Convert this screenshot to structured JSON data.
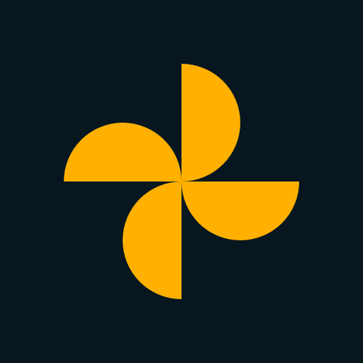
{
  "colors": {
    "background": "#07161F",
    "petal": "#FFB000"
  },
  "logo": {
    "icon": "pinwheel-icon",
    "petal_count": 4
  }
}
